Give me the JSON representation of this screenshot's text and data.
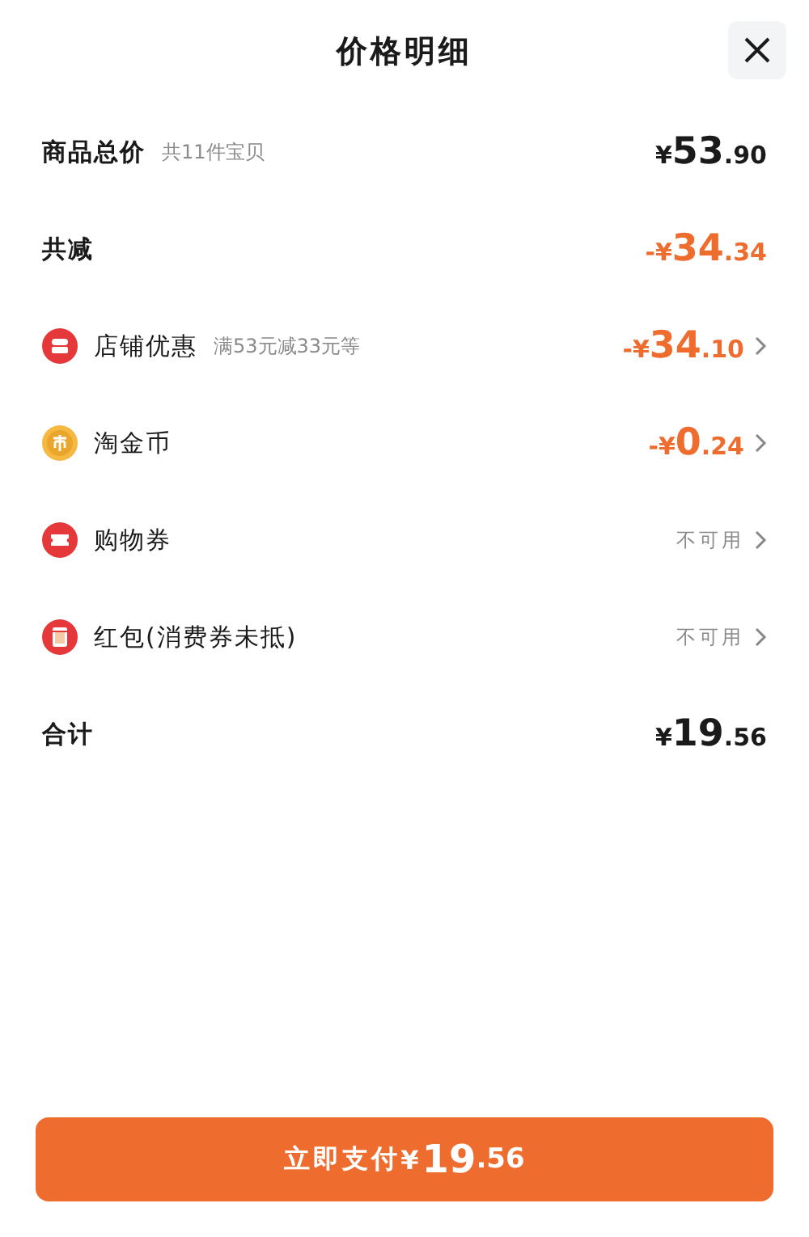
{
  "title": "价格明细",
  "rows": [
    {
      "kind": "sum",
      "label": "商品总价",
      "note": "共11件宝贝",
      "amount": "¥53.90"
    },
    {
      "kind": "reduction",
      "label": "共减",
      "amount": "-¥34.34"
    },
    {
      "kind": "item",
      "label": "店铺优惠",
      "note": "满53元减33元等",
      "amount": "-¥34.10"
    },
    {
      "kind": "item",
      "label": "淘金币",
      "amount": "-¥0.24"
    },
    {
      "kind": "item",
      "label": "购物券",
      "status": "不可用"
    },
    {
      "kind": "item",
      "label": "红包(消费券未抵)",
      "status": "不可用"
    },
    {
      "kind": "sum",
      "label": "合计",
      "amount": "¥19.56"
    }
  ],
  "pay_button": {
    "label": "立即支付",
    "amount": "¥19.56"
  }
}
